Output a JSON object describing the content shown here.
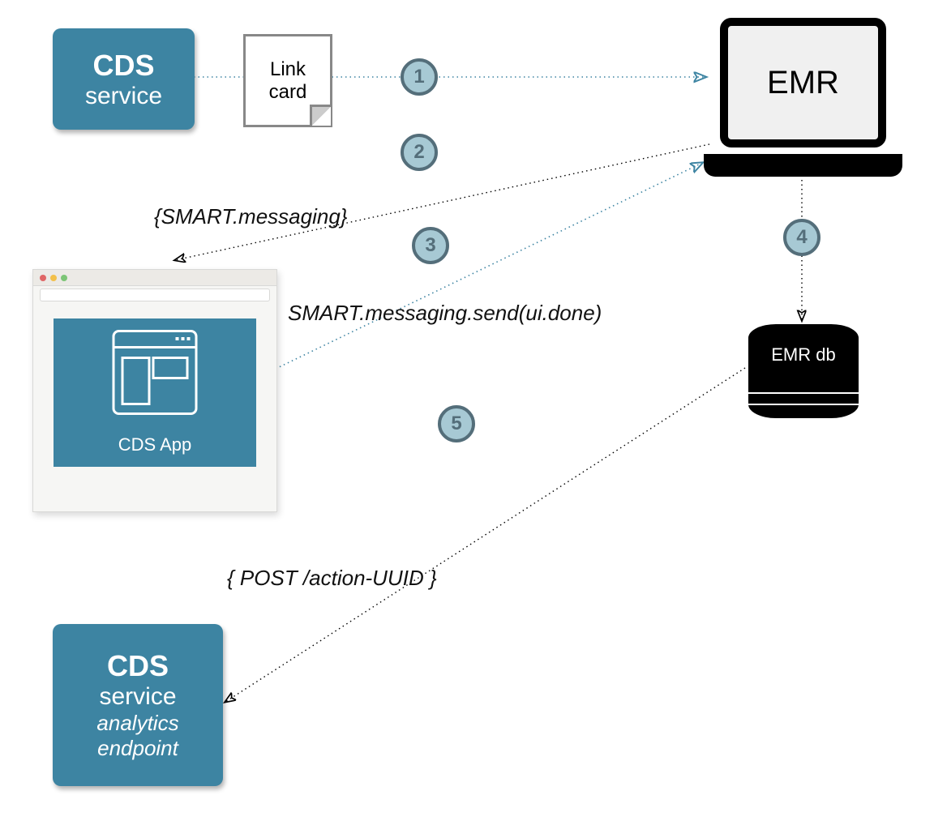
{
  "nodes": {
    "cds_service_top": {
      "line1": "CDS",
      "line2": "service"
    },
    "cds_service_bottom": {
      "line1": "CDS",
      "line2": "service",
      "line3": "analytics",
      "line4": "endpoint"
    },
    "link_card": {
      "line1": "Link",
      "line2": "card"
    },
    "emr": {
      "label": "EMR"
    },
    "emr_db": {
      "label": "EMR db"
    },
    "cds_app": {
      "caption": "CDS App"
    }
  },
  "steps": {
    "s1": "1",
    "s2": "2",
    "s3": "3",
    "s4": "4",
    "s5": "5"
  },
  "annotations": {
    "smart_ctx": "{SMART.messaging}",
    "smart_send": "SMART.messaging.send(ui.done)",
    "post_action": "{ POST /action-UUID }"
  },
  "colors": {
    "teal": "#3d84a2",
    "step_fill": "#a7c9d4",
    "step_border": "#546e7a",
    "dot_red": "#e06666",
    "dot_yellow": "#f3c04a",
    "dot_green": "#7cc576"
  }
}
